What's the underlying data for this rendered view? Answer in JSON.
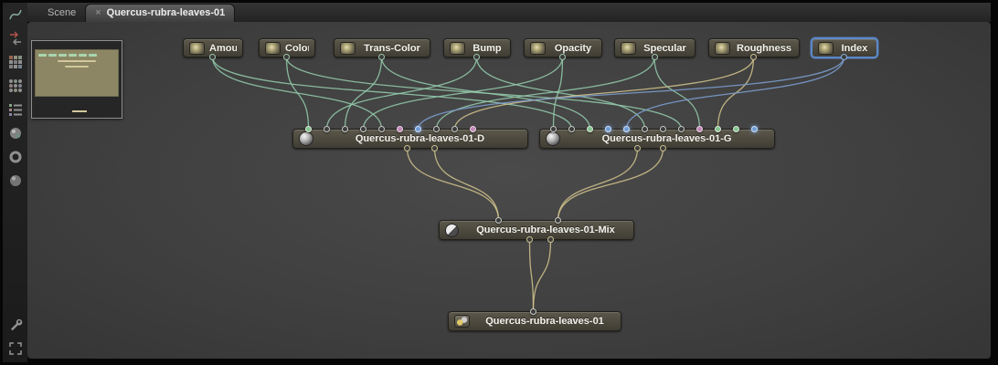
{
  "tabs": {
    "scene_label": "Scene",
    "close_glyph": "×",
    "active_label": "Quercus-rubra-leaves-01"
  },
  "sidebar": {
    "icons": [
      "spline-tool",
      "delete-node",
      "grid-snap",
      "grid-align",
      "node-list",
      "material-ball",
      "torus-primitive",
      "sphere-primitive",
      "settings-wrench",
      "expand-view"
    ]
  },
  "colors": {
    "wire_teal": "#93c9ab",
    "wire_tan": "#cfc08b",
    "wire_blue": "#7d9fd1",
    "selection_blue": "#5e8cd0",
    "minimap_viewport": "#8c8664"
  },
  "graph": {
    "nodes": [
      {
        "id": "amount",
        "label": "Amount",
        "type": "input"
      },
      {
        "id": "color",
        "label": "Color",
        "type": "input"
      },
      {
        "id": "transcolor",
        "label": "Trans-Color",
        "type": "input"
      },
      {
        "id": "bump",
        "label": "Bump",
        "type": "input"
      },
      {
        "id": "opacity",
        "label": "Opacity",
        "type": "input"
      },
      {
        "id": "specular",
        "label": "Specular",
        "type": "input"
      },
      {
        "id": "roughness",
        "label": "Roughness",
        "type": "input"
      },
      {
        "id": "index",
        "label": "Index",
        "type": "input",
        "selected": true
      },
      {
        "id": "d",
        "label": "Quercus-rubra-leaves-01-D",
        "type": "material",
        "ports": [
          {
            "id": "d-0",
            "color": "green"
          },
          {
            "id": "d-1",
            "color": "plain"
          },
          {
            "id": "d-2",
            "color": "plain"
          },
          {
            "id": "d-3",
            "color": "plain"
          },
          {
            "id": "d-4",
            "color": "plain"
          },
          {
            "id": "d-5",
            "color": "pink"
          },
          {
            "id": "d-6",
            "color": "blue"
          },
          {
            "id": "d-7",
            "color": "plain"
          },
          {
            "id": "d-8",
            "color": "plain"
          },
          {
            "id": "d-9",
            "color": "pink"
          }
        ]
      },
      {
        "id": "g",
        "label": "Quercus-rubra-leaves-01-G",
        "type": "material",
        "ports": [
          {
            "id": "g-0",
            "color": "plain"
          },
          {
            "id": "g-1",
            "color": "plain"
          },
          {
            "id": "g-2",
            "color": "green"
          },
          {
            "id": "g-3",
            "color": "blue"
          },
          {
            "id": "g-4",
            "color": "blue"
          },
          {
            "id": "g-5",
            "color": "plain"
          },
          {
            "id": "g-6",
            "color": "plain"
          },
          {
            "id": "g-7",
            "color": "plain"
          },
          {
            "id": "g-8",
            "color": "pink"
          },
          {
            "id": "g-9",
            "color": "green"
          },
          {
            "id": "g-10",
            "color": "green"
          },
          {
            "id": "g-11",
            "color": "blue"
          }
        ]
      },
      {
        "id": "mix",
        "label": "Quercus-rubra-leaves-01-Mix",
        "type": "mixer",
        "ports": [
          {
            "id": "mix-0",
            "color": "plain"
          },
          {
            "id": "mix-1",
            "color": "plain"
          }
        ]
      },
      {
        "id": "out",
        "label": "Quercus-rubra-leaves-01",
        "type": "output",
        "ports": [
          {
            "id": "out-0",
            "color": "plain"
          }
        ]
      }
    ],
    "connections": [
      {
        "from": "amount-out",
        "to": "d-4",
        "color": "#93c9ab"
      },
      {
        "from": "amount-out",
        "to": "g-1",
        "color": "#93c9ab"
      },
      {
        "from": "color-out",
        "to": "d-0",
        "color": "#93c9ab"
      },
      {
        "from": "color-out",
        "to": "g-7",
        "color": "#93c9ab"
      },
      {
        "from": "transcolor-out",
        "to": "d-2",
        "color": "#93c9ab"
      },
      {
        "from": "transcolor-out",
        "to": "g-2",
        "color": "#93c9ab"
      },
      {
        "from": "bump-out",
        "to": "d-1",
        "color": "#93c9ab"
      },
      {
        "from": "bump-out",
        "to": "g-5",
        "color": "#93c9ab"
      },
      {
        "from": "opacity-out",
        "to": "d-3",
        "color": "#93c9ab"
      },
      {
        "from": "opacity-out",
        "to": "g-0",
        "color": "#93c9ab"
      },
      {
        "from": "specular-out",
        "to": "d-7",
        "color": "#93c9ab"
      },
      {
        "from": "specular-out",
        "to": "g-8",
        "color": "#93c9ab"
      },
      {
        "from": "roughness-out",
        "to": "d-8",
        "color": "#cfc08b"
      },
      {
        "from": "roughness-out",
        "to": "g-9",
        "color": "#cfc08b"
      },
      {
        "from": "index-out",
        "to": "d-6",
        "color": "#7d9fd1"
      },
      {
        "from": "index-out",
        "to": "g-4",
        "color": "#7d9fd1"
      },
      {
        "from": "d-outa",
        "to": "mix-0",
        "color": "#cfc08b"
      },
      {
        "from": "d-outb",
        "to": "mix-0",
        "color": "#cfc08b"
      },
      {
        "from": "g-outa",
        "to": "mix-1",
        "color": "#cfc08b"
      },
      {
        "from": "g-outb",
        "to": "mix-1",
        "color": "#cfc08b"
      },
      {
        "from": "mix-outa",
        "to": "out-0",
        "color": "#cfc08b"
      },
      {
        "from": "mix-outb",
        "to": "out-0",
        "color": "#cfc08b"
      }
    ]
  }
}
